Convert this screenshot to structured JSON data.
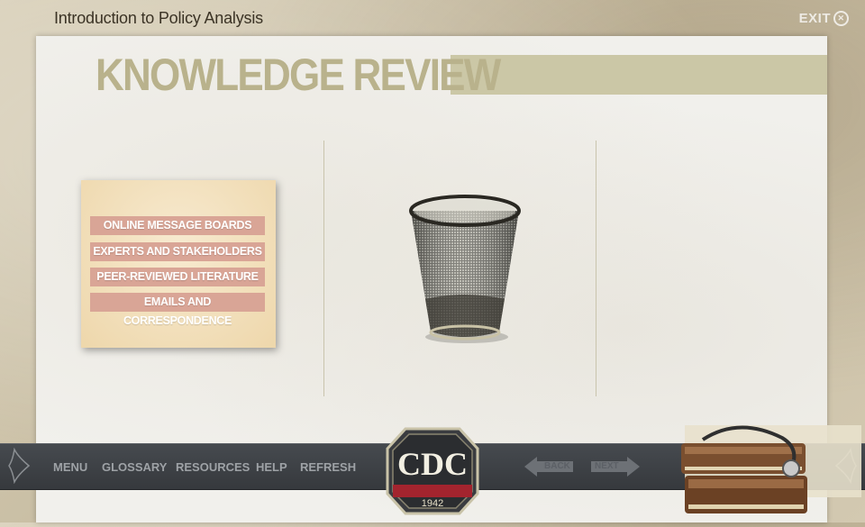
{
  "header": {
    "course_title": "Introduction to Policy Analysis",
    "exit_label": "EXIT"
  },
  "page": {
    "heading": "KNOWLEDGE REVIEW"
  },
  "drag_items": [
    {
      "label": "ONLINE MESSAGE BOARDS"
    },
    {
      "label": "EXPERTS AND STAKEHOLDERS"
    },
    {
      "label": "PEER-REVIEWED LITERATURE"
    },
    {
      "label": "EMAILS AND CORRESPONDENCE"
    }
  ],
  "trash": {
    "icon": "wastebasket-icon"
  },
  "nav": {
    "menu": "MENU",
    "glossary": "GLOSSARY",
    "resources": "RESOURCES",
    "help": "HELP",
    "refresh": "REFRESH",
    "back": "BACK",
    "next": "NEXT"
  },
  "logo": {
    "text": "CDC",
    "year": "1942"
  },
  "colors": {
    "heading": "#b9b28c",
    "heading_bar": "#cbc7a6",
    "chip": "#d9a596",
    "card": "#f4e3bf",
    "navbar": "#3e4146",
    "nav_text": "#9ea2a6"
  }
}
